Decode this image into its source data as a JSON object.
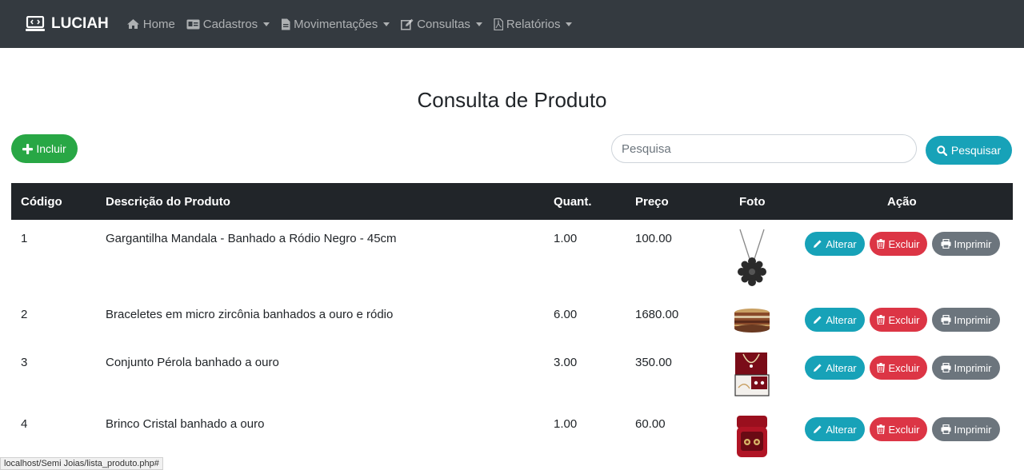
{
  "nav": {
    "brand": "LUCIAH",
    "items": [
      {
        "label": "Home",
        "icon": "home-icon",
        "dropdown": false
      },
      {
        "label": "Cadastros",
        "icon": "id-card-icon",
        "dropdown": true
      },
      {
        "label": "Movimentações",
        "icon": "file-icon",
        "dropdown": true
      },
      {
        "label": "Consultas",
        "icon": "edit-icon",
        "dropdown": true
      },
      {
        "label": "Relatórios",
        "icon": "pdf-file-icon",
        "dropdown": true
      }
    ]
  },
  "page": {
    "title": "Consulta de Produto",
    "include_label": "Incluir",
    "search_placeholder": "Pesquisa",
    "search_value": "",
    "search_button_label": "Pesquisar"
  },
  "table": {
    "headers": [
      "Código",
      "Descrição do Produto",
      "Quant.",
      "Preço",
      "Foto",
      "Ação"
    ],
    "rows": [
      {
        "code": "1",
        "description": "Gargantilha Mandala - Banhado a Ródio Negro - 45cm",
        "qty": "1.00",
        "price": "100.00",
        "photo": "necklace"
      },
      {
        "code": "2",
        "description": "Braceletes em micro zircônia banhados a ouro e ródio",
        "qty": "6.00",
        "price": "1680.00",
        "photo": "bracelets"
      },
      {
        "code": "3",
        "description": "Conjunto Pérola banhado a ouro",
        "qty": "3.00",
        "price": "350.00",
        "photo": "pearl-set"
      },
      {
        "code": "4",
        "description": "Brinco Cristal banhado a ouro",
        "qty": "1.00",
        "price": "60.00",
        "photo": "earrings-box"
      }
    ],
    "actions": {
      "edit": "Alterar",
      "delete": "Excluir",
      "print": "Imprimir"
    }
  },
  "status_bar": {
    "url": "localhost/Semi Joias/lista_produto.php#"
  },
  "colors": {
    "navbar": "#343a40",
    "success": "#28a745",
    "info": "#17a2b8",
    "danger": "#dc3545",
    "secondary": "#6c757d",
    "table_head": "#212529"
  }
}
